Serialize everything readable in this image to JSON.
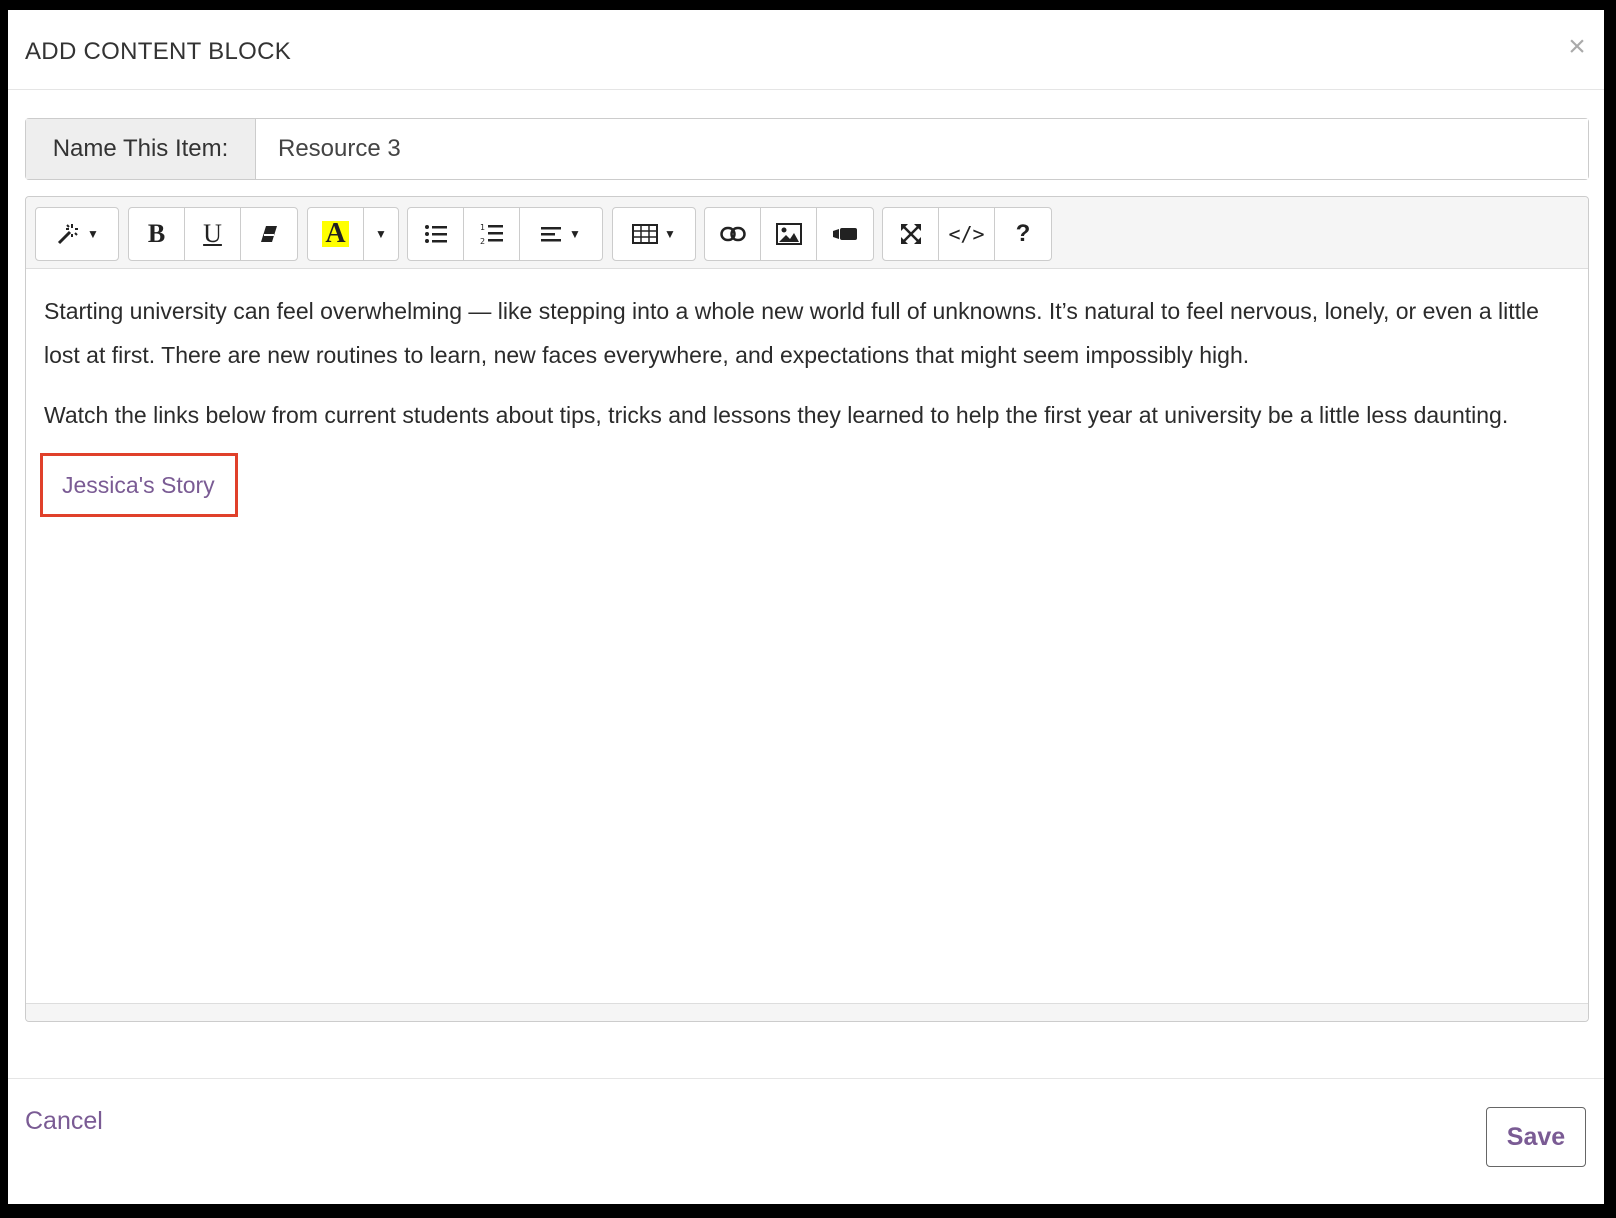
{
  "modal": {
    "title": "ADD CONTENT BLOCK",
    "close_label": "×"
  },
  "name_field": {
    "label": "Name This Item:",
    "value": "Resource 3"
  },
  "toolbar": {
    "groups": [
      {
        "buttons": [
          "magic-wand-icon"
        ]
      },
      {
        "buttons": [
          "bold-icon",
          "underline-icon",
          "eraser-icon"
        ]
      },
      {
        "buttons": [
          "text-color-icon",
          "caret-down-icon"
        ]
      },
      {
        "buttons": [
          "unordered-list-icon",
          "ordered-list-icon",
          "align-icon"
        ]
      },
      {
        "buttons": [
          "table-icon"
        ]
      },
      {
        "buttons": [
          "link-icon",
          "image-icon",
          "video-icon"
        ]
      },
      {
        "buttons": [
          "fullscreen-icon",
          "code-view-icon",
          "help-icon"
        ]
      }
    ],
    "bold_label": "B",
    "underline_label": "U",
    "text_color_label": "A",
    "code_label": "</>",
    "help_label": "?",
    "highlight_color": "#ffff00"
  },
  "editor": {
    "paragraphs": [
      "Starting university can feel overwhelming — like stepping into a whole new world full of unknowns. It’s natural to feel nervous, lonely, or even a little lost at first. There are new routines to learn, new faces everywhere, and expectations that might seem impossibly high.",
      "Watch the links below from current students about tips, tricks and lessons they learned to help the first year at university be a little less daunting."
    ],
    "link_text": "Jessica's Story"
  },
  "footer": {
    "cancel_label": "Cancel",
    "save_label": "Save"
  },
  "colors": {
    "link": "#7a5b94",
    "highlight_border": "#e0402a"
  }
}
